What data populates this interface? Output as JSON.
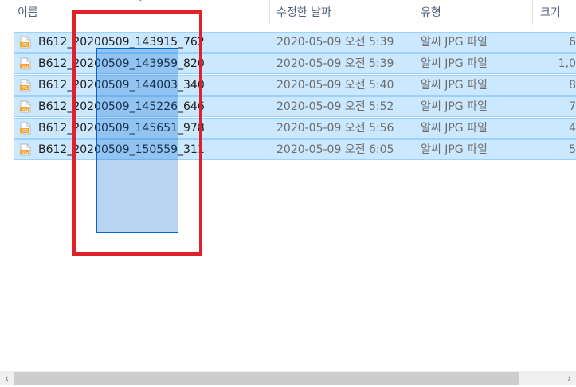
{
  "header": {
    "columns": [
      "이름",
      "수정한 날짜",
      "유형",
      "크기"
    ],
    "sort_indicator": "⌃"
  },
  "files": [
    {
      "name": "B612_20200509_143915_762",
      "date": "2020-05-09 오전 5:39",
      "type": "알씨 JPG 파일",
      "size": "6"
    },
    {
      "name": "B612_20200509_143959_820",
      "date": "2020-05-09 오전 5:39",
      "type": "알씨 JPG 파일",
      "size": "1,0"
    },
    {
      "name": "B612_20200509_144003_340",
      "date": "2020-05-09 오전 5:40",
      "type": "알씨 JPG 파일",
      "size": "8"
    },
    {
      "name": "B612_20200509_145226_646",
      "date": "2020-05-09 오전 5:52",
      "type": "알씨 JPG 파일",
      "size": "7"
    },
    {
      "name": "B612_20200509_145651_978",
      "date": "2020-05-09 오전 5:56",
      "type": "알씨 JPG 파일",
      "size": "4"
    },
    {
      "name": "B612_20200509_150559_311",
      "date": "2020-05-09 오전 6:05",
      "type": "알씨 JPG 파일",
      "size": "5"
    }
  ],
  "icons": {
    "file": "jpg-file-icon",
    "scroll_left": "chevron-left-icon",
    "scroll_right": "chevron-right-icon"
  },
  "scroll": {
    "left_glyph": "‹",
    "right_glyph": "›"
  },
  "colors": {
    "selection_bg": "#cce8ff",
    "selection_border": "#99d1ff",
    "marquee": "#0066cc",
    "highlight": "#e0202a",
    "jpg_badge": "#f3a42b"
  },
  "file_icon_label": "JPG"
}
